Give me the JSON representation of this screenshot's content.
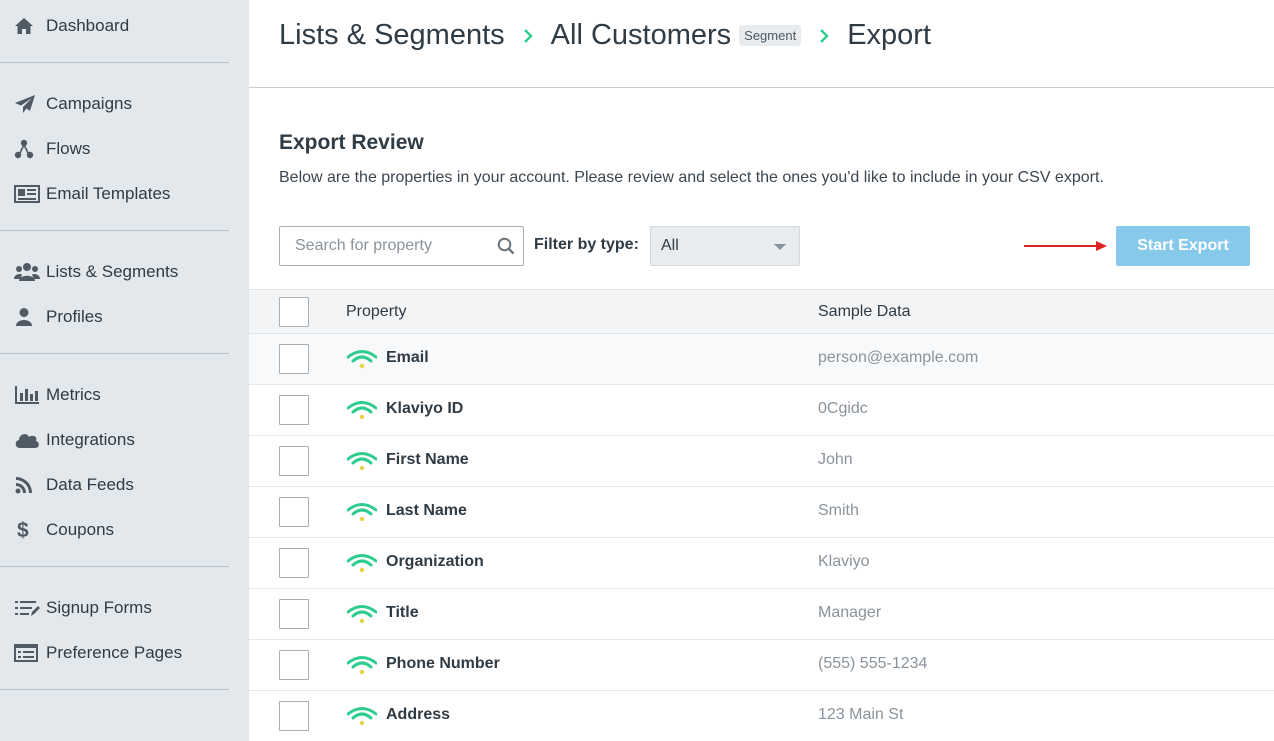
{
  "sidebar": {
    "groups": [
      [
        {
          "label": "Dashboard",
          "icon": "home-icon"
        }
      ],
      [
        {
          "label": "Campaigns",
          "icon": "paper-plane-icon"
        },
        {
          "label": "Flows",
          "icon": "flow-icon"
        },
        {
          "label": "Email Templates",
          "icon": "template-icon"
        }
      ],
      [
        {
          "label": "Lists & Segments",
          "icon": "users-icon"
        },
        {
          "label": "Profiles",
          "icon": "user-icon"
        }
      ],
      [
        {
          "label": "Metrics",
          "icon": "bar-chart-icon"
        },
        {
          "label": "Integrations",
          "icon": "cloud-icon"
        },
        {
          "label": "Data Feeds",
          "icon": "rss-icon"
        },
        {
          "label": "Coupons",
          "icon": "dollar-icon"
        }
      ],
      [
        {
          "label": "Signup Forms",
          "icon": "form-list-icon"
        },
        {
          "label": "Preference Pages",
          "icon": "preference-page-icon"
        }
      ]
    ]
  },
  "breadcrumb": {
    "items": [
      "Lists & Segments",
      "All Customers",
      "Export"
    ],
    "badge": "Segment"
  },
  "review": {
    "title": "Export Review",
    "description": "Below are the properties in your account. Please review and select the ones you'd like to include in your CSV export."
  },
  "toolbar": {
    "search_placeholder": "Search for property",
    "filter_label": "Filter by type:",
    "filter_value": "All",
    "start_export_label": "Start Export"
  },
  "table": {
    "columns": [
      "Property",
      "Sample Data"
    ],
    "rows": [
      {
        "property": "Email",
        "sample": "person@example.com"
      },
      {
        "property": "Klaviyo ID",
        "sample": "0Cgidc"
      },
      {
        "property": "First Name",
        "sample": "John"
      },
      {
        "property": "Last Name",
        "sample": "Smith"
      },
      {
        "property": "Organization",
        "sample": "Klaviyo"
      },
      {
        "property": "Title",
        "sample": "Manager"
      },
      {
        "property": "Phone Number",
        "sample": "(555) 555-1234"
      },
      {
        "property": "Address",
        "sample": "123 Main St"
      }
    ]
  },
  "colors": {
    "accent_green": "#2ecc8e",
    "signal_yellow": "#e8d245",
    "start_button": "#87c9ea",
    "arrow_red": "#e02424"
  }
}
